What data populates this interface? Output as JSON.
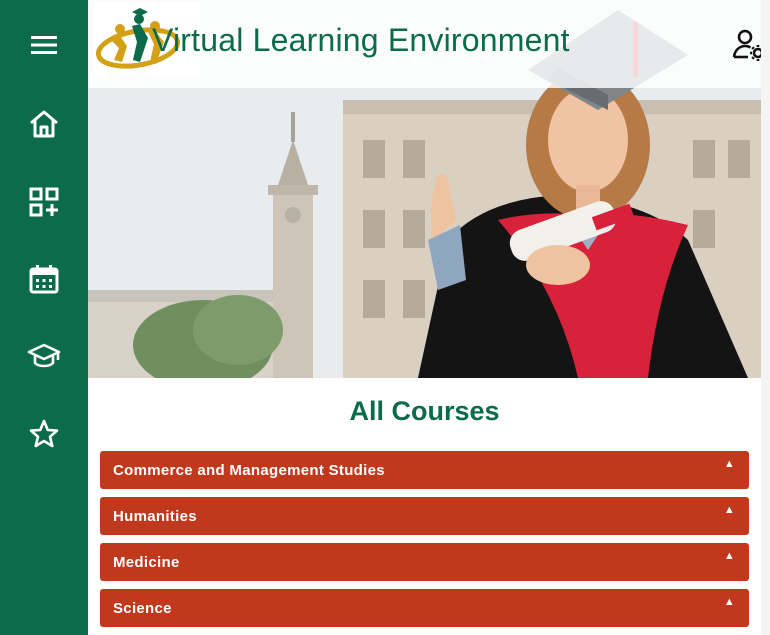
{
  "header": {
    "title": "Virtual Learning Environment"
  },
  "icons": {
    "menu": "hamburger-menu-icon",
    "home": "home-icon",
    "apps": "apps-add-icon",
    "calendar": "calendar-icon",
    "courses": "graduation-cap-icon",
    "favorites": "star-icon",
    "user_settings": "user-gear-icon"
  },
  "main": {
    "section_title": "All Courses",
    "categories": [
      {
        "label": "Commerce and Management Studies"
      },
      {
        "label": "Humanities"
      },
      {
        "label": "Medicine"
      },
      {
        "label": "Science"
      }
    ]
  },
  "colors": {
    "brand_green": "#0b6b4a",
    "accordion_red": "#c0391d",
    "logo_gold": "#d4a017"
  }
}
